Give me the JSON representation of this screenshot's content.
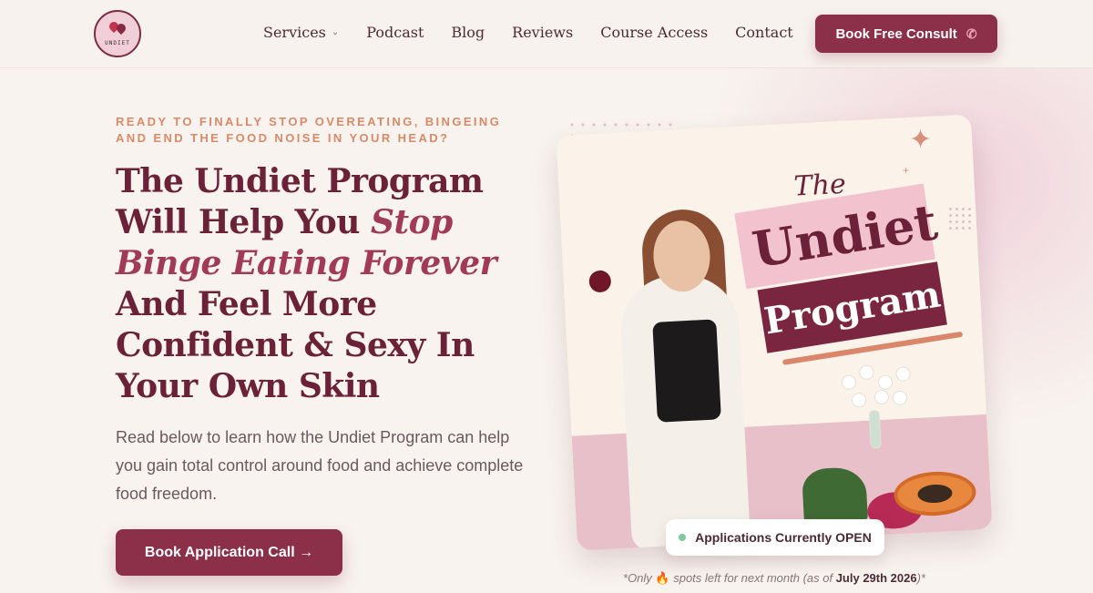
{
  "nav": {
    "logo_text": "UNDIET",
    "items": [
      {
        "label": "Services",
        "has_dropdown": true
      },
      {
        "label": "Podcast"
      },
      {
        "label": "Blog"
      },
      {
        "label": "Reviews"
      },
      {
        "label": "Course Access"
      },
      {
        "label": "Contact"
      }
    ],
    "consult_label": "Book Free Consult",
    "consult_icon": "phone-icon"
  },
  "hero": {
    "eyebrow_line1": "READY TO FINALLY STOP OVEREATING, BINGEING",
    "eyebrow_line2": "AND END THE FOOD NOISE IN YOUR HEAD?",
    "headline_part1": "The Undiet Program Will Help You ",
    "headline_emphasis": "Stop Binge Eating Forever",
    "headline_part2": " And Feel More Confident & Sexy In Your Own Skin",
    "lead": "Read below to learn how the Undiet Program can help you gain total control around food and achieve complete food freedom.",
    "cta_label": "Book Application Call →"
  },
  "card": {
    "title_the": "The",
    "title_undiet": "Undiet",
    "title_program": "Program"
  },
  "status": {
    "badge_label": "Applications Currently OPEN",
    "badge_color": "#7fc99a",
    "note_prefix": "*Only ",
    "note_icon": "🔥",
    "note_middle": " spots left for next month (as of ",
    "note_date": "July 29th 2026",
    "note_suffix": ")*"
  },
  "colors": {
    "brand": "#8b3048",
    "headline": "#6b2238",
    "accent_emphasis": "#a03a58",
    "eyebrow": "#d88a68",
    "background": "#f8f3ee"
  }
}
